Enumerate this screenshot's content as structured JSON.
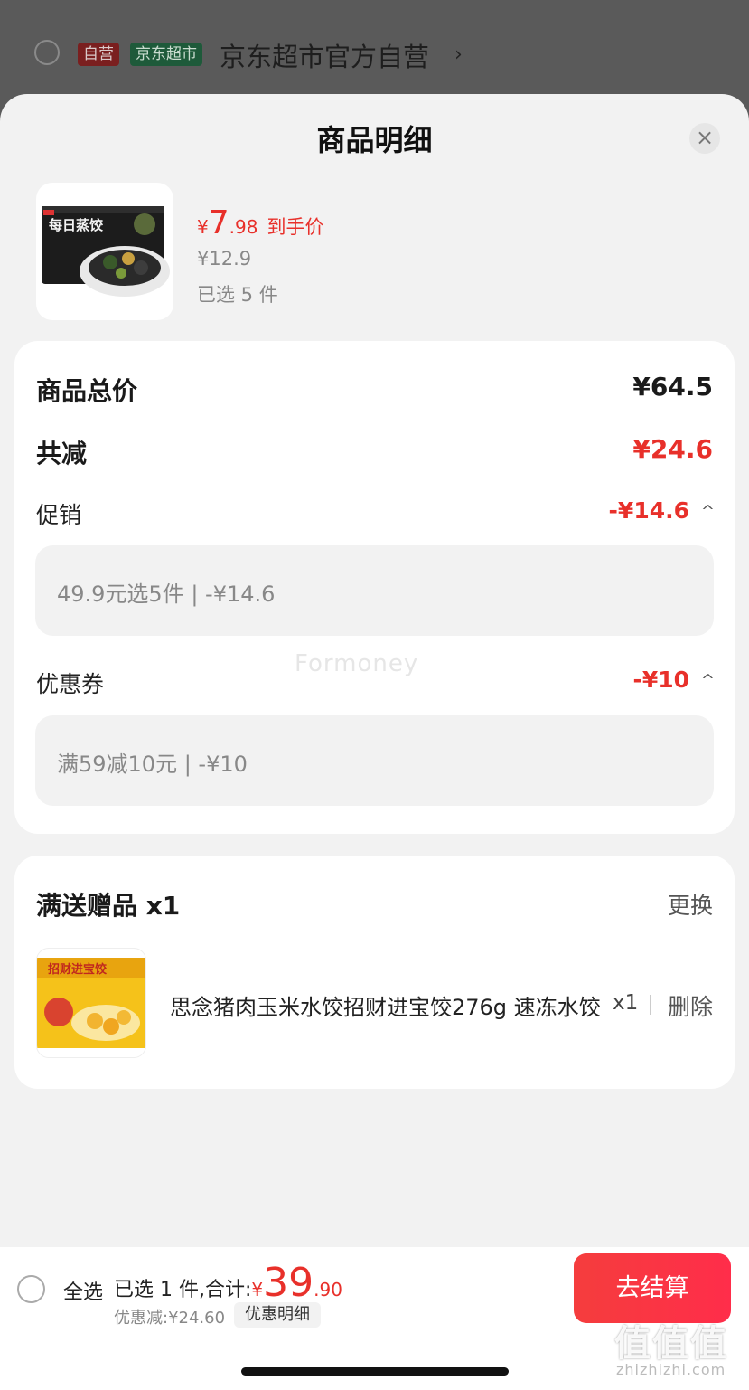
{
  "store_row": {
    "tag_self": "自营",
    "tag_market": "京东超市",
    "store_name": "京东超市官方自营",
    "chevron": "›"
  },
  "sheet": {
    "title": "商品明细",
    "close_icon": "×"
  },
  "product": {
    "image_text": "每日蒸饺",
    "price_symbol": "¥",
    "price_int": "7",
    "price_dec": ".98",
    "price_label": "到手价",
    "original_price": "¥12.9",
    "selected": "已选 5 件"
  },
  "summary": {
    "total_label": "商品总价",
    "total_value": "¥64.5",
    "reduce_label": "共减",
    "reduce_value": "¥24.6",
    "promo_label": "促销",
    "promo_value": "-¥14.6",
    "promo_detail": "49.9元选5件 | -¥14.6",
    "coupon_label": "优惠券",
    "coupon_value": "-¥10",
    "coupon_detail": "满59减10元 | -¥10",
    "caret": "^",
    "watermark": "Formoney"
  },
  "gift": {
    "title": "满送赠品 x1",
    "change": "更换",
    "image_text": "招财进宝饺",
    "name": "思念猪肉玉米水饺招财进宝饺276g 速冻水饺",
    "qty": "x1",
    "delete": "删除"
  },
  "bottom_bar": {
    "select_all": "全选",
    "selected_text": "已选 1 件,合计:",
    "total_symbol": "¥",
    "total_int": "39",
    "total_dec": ".90",
    "discount_text": "优惠减:¥24.60",
    "discount_detail": "优惠明细",
    "checkout": "去结算"
  },
  "corner_watermark": {
    "main": "值值值",
    "sub": "zhizhizhi.com"
  },
  "colors": {
    "accent_red": "#e8302a",
    "checkout_gradient_start": "#f53d3d",
    "checkout_gradient_end": "#ff2d4a"
  }
}
